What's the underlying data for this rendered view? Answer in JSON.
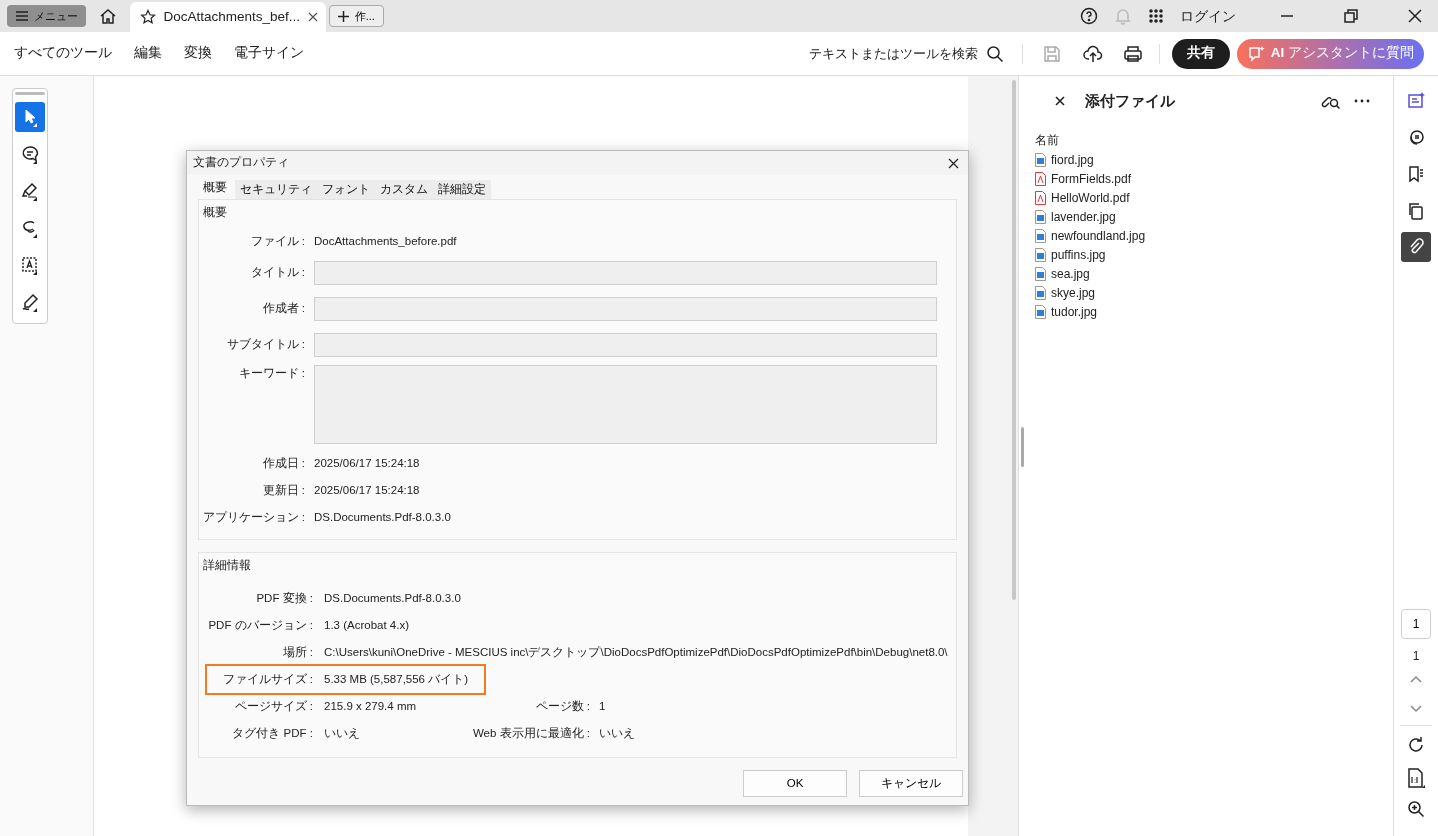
{
  "titlebar": {
    "menu_button": "メニュー",
    "tab": {
      "title": "DocAttachments_bef..."
    },
    "new_tab_button": "作...",
    "login": "ログイン"
  },
  "toolbar": {
    "menu_items": [
      "すべてのツール",
      "編集",
      "変換",
      "電子サイン"
    ],
    "search_label": "テキストまたはツールを検索",
    "share_button": "共有",
    "ai_button": "**AI** アシスタントに質問"
  },
  "tools": [
    {
      "kind": "select",
      "selected": true
    },
    {
      "kind": "comment",
      "selected": false
    },
    {
      "kind": "highlight",
      "selected": false
    },
    {
      "kind": "draw",
      "selected": false
    },
    {
      "kind": "text",
      "selected": false
    },
    {
      "kind": "sign",
      "selected": false
    }
  ],
  "dialog": {
    "title": "文書のプロパティ",
    "tabs": [
      {
        "label": "概要",
        "selected": true
      },
      {
        "label": "セキュリティ",
        "selected": false
      },
      {
        "label": "フォント",
        "selected": false
      },
      {
        "label": "カスタム",
        "selected": false
      },
      {
        "label": "詳細設定",
        "selected": false
      }
    ],
    "summary": {
      "title": "概要",
      "fields": [
        {
          "label": "ファイル :",
          "kind": "text",
          "value": "DocAttachments_before.pdf"
        },
        {
          "label": "タイトル :",
          "kind": "input"
        },
        {
          "label": "作成者 :",
          "kind": "input"
        },
        {
          "label": "サブタイトル :",
          "kind": "input"
        },
        {
          "label": "キーワード :",
          "kind": "textarea"
        },
        {
          "label": "作成日 :",
          "kind": "text",
          "value": "2025/06/17 15:24:18"
        },
        {
          "label": "更新日 :",
          "kind": "text",
          "value": "2025/06/17 15:24:18"
        },
        {
          "label": "アプリケーション :",
          "kind": "text",
          "value": "DS.Documents.Pdf-8.0.3.0"
        }
      ]
    },
    "details": {
      "title": "詳細情報",
      "rows": [
        {
          "highlighted": false,
          "pairs": [
            {
              "label": "PDF 変換 :",
              "value": "DS.Documents.Pdf-8.0.3.0"
            }
          ]
        },
        {
          "highlighted": false,
          "pairs": [
            {
              "label": "PDF のバージョン :",
              "value": "1.3 (Acrobat 4.x)"
            }
          ]
        },
        {
          "highlighted": false,
          "pairs": [
            {
              "label": "場所 :",
              "value": "C:\\Users\\kuni\\OneDrive - MESCIUS inc\\デスクトップ\\DioDocsPdfOptimizePdf\\DioDocsPdfOptimizePdf\\bin\\Debug\\net8.0\\"
            }
          ]
        },
        {
          "highlighted": true,
          "pairs": [
            {
              "label": "ファイルサイズ :",
              "value": "5.33 MB (5,587,556 バイト)"
            }
          ]
        },
        {
          "highlighted": false,
          "pairs": [
            {
              "label": "ページサイズ :",
              "value": "215.9 x 279.4 mm"
            },
            {
              "label": "ページ数 :",
              "value": "1"
            }
          ]
        },
        {
          "highlighted": false,
          "pairs": [
            {
              "label": "タグ付き PDF :",
              "value": "いいえ"
            },
            {
              "label": "Web 表示用に最適化 :",
              "value": "いいえ"
            }
          ]
        }
      ]
    },
    "buttons": [
      "OK",
      "キャンセル"
    ]
  },
  "attachments": {
    "title": "添付ファイル",
    "column": "名前",
    "files": [
      {
        "name": "fiord.jpg",
        "kind": "image"
      },
      {
        "name": "FormFields.pdf",
        "kind": "pdf"
      },
      {
        "name": "HelloWorld.pdf",
        "kind": "pdf"
      },
      {
        "name": "lavender.jpg",
        "kind": "image"
      },
      {
        "name": "newfoundland.jpg",
        "kind": "image"
      },
      {
        "name": "puffins.jpg",
        "kind": "image"
      },
      {
        "name": "sea.jpg",
        "kind": "image"
      },
      {
        "name": "skye.jpg",
        "kind": "image"
      },
      {
        "name": "tudor.jpg",
        "kind": "image"
      }
    ]
  },
  "right_rail": {
    "tools": [
      {
        "kind": "ai",
        "selected": false
      },
      {
        "kind": "comments",
        "selected": false
      },
      {
        "kind": "bookmarks",
        "selected": false
      },
      {
        "kind": "pages",
        "selected": false
      },
      {
        "kind": "attachments",
        "selected": true
      }
    ],
    "page_input": "1",
    "page_count": "1"
  }
}
